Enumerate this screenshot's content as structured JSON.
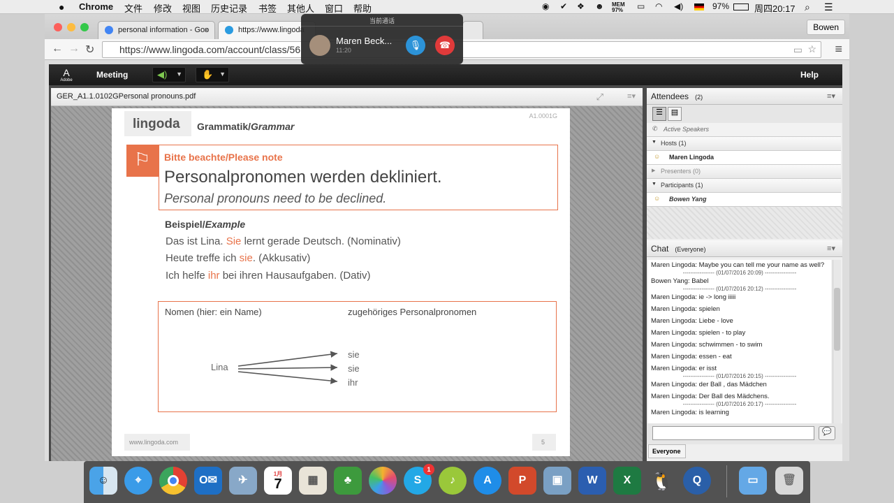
{
  "menubar": {
    "app": "Chrome",
    "items": [
      "文件",
      "修改",
      "视图",
      "历史记录",
      "书签",
      "其他人",
      "窗口",
      "帮助"
    ],
    "mem_label": "MEM",
    "mem_value": "97%",
    "battery": "97%",
    "clock": "周四20:17"
  },
  "browser": {
    "tabs": [
      {
        "title": "personal information - Goo"
      },
      {
        "title": "https://www.lingoda"
      }
    ],
    "url": "https://www.lingoda.com/account/class/56",
    "profile": "Bowen"
  },
  "call": {
    "header": "当前通话",
    "name": "Maren Beck...",
    "time": "11:20"
  },
  "adobe": {
    "logo": "Adobe",
    "meeting_label": "Meeting",
    "help_label": "Help"
  },
  "document": {
    "filename": "GER_A1.1.0102GPersonal pronouns.pdf"
  },
  "slide": {
    "code": "A1.0001G",
    "brand": "lingoda",
    "section_bold": "Grammatik/",
    "section_italic": "Grammar",
    "note_label": "Bitte beachte/Please note",
    "main_de": "Personalpronomen werden dekliniert.",
    "main_en": "Personal pronouns need to be declined.",
    "example_bold": "Beispiel/",
    "example_italic": "Example",
    "examples": [
      {
        "pre": "Das ist Lina. ",
        "hl": "Sie",
        "post": " lernt gerade Deutsch. (Nominativ)"
      },
      {
        "pre": "Heute treffe ich ",
        "hl": "sie",
        "post": ". (Akkusativ)"
      },
      {
        "pre": "Ich helfe ",
        "hl": "ihr",
        "post": " bei ihren Hausaufgaben. (Dativ)"
      }
    ],
    "table_col1": "Nomen (hier: ein Name)",
    "table_col2": "zugehöriges Personalpronomen",
    "noun": "Lina",
    "pronouns": [
      "sie",
      "sie",
      "ihr"
    ],
    "footer_url": "www.lingoda.com",
    "page": "5"
  },
  "attendees": {
    "title": "Attendees",
    "count": "(2)",
    "active_speakers": "Active Speakers",
    "hosts_label": "Hosts (1)",
    "host": "Maren Lingoda",
    "presenters_label": "Presenters (0)",
    "participants_label": "Participants (1)",
    "participant": "Bowen Yang"
  },
  "chat": {
    "title": "Chat",
    "scope": "(Everyone)",
    "messages": [
      {
        "text": "Maren Lingoda: Maybe you can tell me your name as well?"
      },
      {
        "sep": "----------------- (01/07/2016 20:09) -----------------"
      },
      {
        "text": "Bowen Yang: Babel"
      },
      {
        "sep": "----------------- (01/07/2016 20:12) -----------------"
      },
      {
        "text": "Maren Lingoda: ie -> long iiiii"
      },
      {
        "text": "Maren Lingoda: spielen"
      },
      {
        "text": "Maren Lingoda: Liebe - love"
      },
      {
        "text": "Maren Lingoda: spielen - to play"
      },
      {
        "text": "Maren Lingoda: schwimmen - to swim"
      },
      {
        "text": "Maren Lingoda: essen - eat"
      },
      {
        "text": "Maren Lingoda: er isst"
      },
      {
        "sep": "----------------- (01/07/2016 20:15) -----------------"
      },
      {
        "text": "Maren Lingoda: der Ball , das Mädchen"
      },
      {
        "text": "Maren Lingoda: Der Ball des Mädchens."
      },
      {
        "sep": "----------------- (01/07/2016 20:17) -----------------"
      },
      {
        "text": "Maren Lingoda: is learning"
      }
    ],
    "input_value": "",
    "tab_label": "Everyone"
  },
  "dock": {
    "calendar_month": "1月",
    "calendar_day": "7",
    "skype_badge": "1"
  },
  "colors": {
    "accent": "#e8734a",
    "adobe_bar": "#222222",
    "link_orange": "#e8734a"
  }
}
